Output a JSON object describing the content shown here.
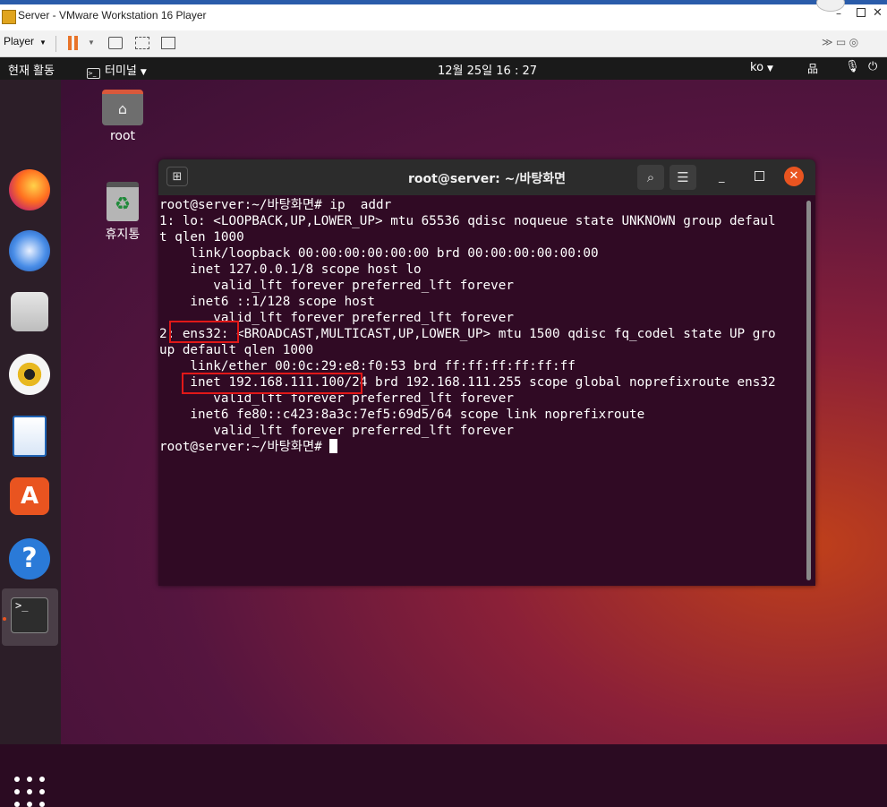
{
  "vmware": {
    "title": "Server - VMware Workstation 16 Player",
    "player_menu": "Player"
  },
  "ubuntu": {
    "activities": "현재 활동",
    "app_menu": "터미널",
    "clock": "12월 25일  16 : 27",
    "language": "ko"
  },
  "desktop_icons": [
    {
      "label": "root",
      "icon": "home-folder-icon"
    },
    {
      "label": "휴지통",
      "icon": "trash-icon"
    }
  ],
  "dock": [
    "firefox-icon",
    "thunderbird-icon",
    "files-icon",
    "rhythmbox-icon",
    "libreoffice-writer-icon",
    "ubuntu-software-icon",
    "help-icon",
    "terminal-icon",
    "show-applications-icon"
  ],
  "terminal": {
    "title": "root@server: ~/바탕화면",
    "lines": [
      "root@server:~/바탕화면# ip  addr",
      "1: lo: <LOOPBACK,UP,LOWER_UP> mtu 65536 qdisc noqueue state UNKNOWN group defaul",
      "t qlen 1000",
      "    link/loopback 00:00:00:00:00:00 brd 00:00:00:00:00:00",
      "    inet 127.0.0.1/8 scope host lo",
      "       valid_lft forever preferred_lft forever",
      "    inet6 ::1/128 scope host",
      "       valid_lft forever preferred_lft forever",
      "2: ens32: <BROADCAST,MULTICAST,UP,LOWER_UP> mtu 1500 qdisc fq_codel state UP gro",
      "up default qlen 1000",
      "    link/ether 00:0c:29:e8:f0:53 brd ff:ff:ff:ff:ff:ff",
      "    inet 192.168.111.100/24 brd 192.168.111.255 scope global noprefixroute ens32",
      "       valid_lft forever preferred_lft forever",
      "    inet6 fe80::c423:8a3c:7ef5:69d5/64 scope link noprefixroute",
      "       valid_lft forever preferred_lft forever"
    ],
    "prompt": "root@server:~/바탕화면# "
  },
  "colors": {
    "terminal_bg": "#300a24",
    "ubuntu_orange": "#e95420",
    "highlight": "#e11818"
  }
}
